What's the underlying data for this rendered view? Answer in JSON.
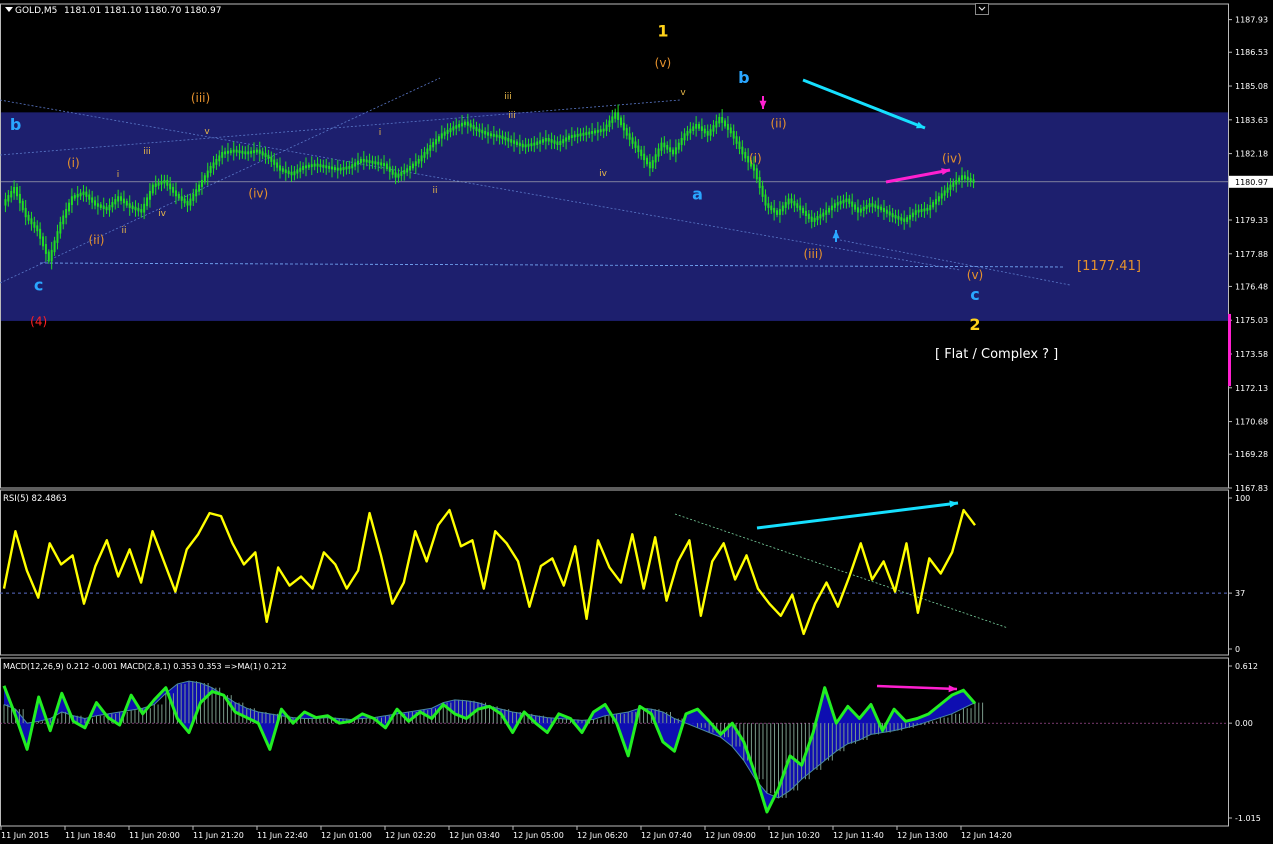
{
  "window": {
    "symbol": "GOLD,M5",
    "ohlc": "1181.01 1181.10 1180.70 1180.97"
  },
  "colors": {
    "background": "#000000",
    "zone": "#1d1f6e",
    "candles": "#22dd22",
    "rsi": "#ffff00",
    "macd_line": "#22ee22",
    "macd_hist": "#1010d0",
    "wave_orange": "#e6922d",
    "wave_yellow": "#ffd21a",
    "wave_blue": "#2aa6ff",
    "wave_red": "#ff2020",
    "arrow_cyan": "#16e0ff",
    "arrow_magenta": "#ff20d0"
  },
  "chart_data": [
    {
      "type": "line",
      "panel": "price",
      "ylim": [
        1167.83,
        1188.6
      ],
      "yticks": [
        "1187.93",
        "1186.53",
        "1185.08",
        "1183.63",
        "1182.18",
        "1180.97",
        "1179.33",
        "1177.88",
        "1176.48",
        "1175.03",
        "1173.58",
        "1172.13",
        "1170.68",
        "1169.28",
        "1167.83"
      ],
      "current_price": "1180.97",
      "xticks": [
        "11 Jun 2015",
        "11 Jun 18:40",
        "11 Jun 20:00",
        "11 Jun 21:20",
        "11 Jun 22:40",
        "12 Jun 01:00",
        "12 Jun 02:20",
        "12 Jun 03:40",
        "12 Jun 05:00",
        "12 Jun 06:20",
        "12 Jun 07:40",
        "12 Jun 09:00",
        "12 Jun 10:20",
        "12 Jun 11:40",
        "12 Jun 13:00",
        "12 Jun 14:20"
      ],
      "close_path": [
        [
          0,
          1180.0
        ],
        [
          1,
          1180.7
        ],
        [
          2,
          1179.5
        ],
        [
          3,
          1178.9
        ],
        [
          4,
          1177.6
        ],
        [
          5,
          1179.2
        ],
        [
          6,
          1180.3
        ],
        [
          7,
          1180.5
        ],
        [
          8,
          1180.0
        ],
        [
          9,
          1179.8
        ],
        [
          10,
          1180.3
        ],
        [
          11,
          1179.9
        ],
        [
          12,
          1179.7
        ],
        [
          13,
          1180.8
        ],
        [
          14,
          1181.0
        ],
        [
          15,
          1180.4
        ],
        [
          16,
          1180.0
        ],
        [
          17,
          1180.8
        ],
        [
          18,
          1181.6
        ],
        [
          19,
          1182.2
        ],
        [
          20,
          1182.3
        ],
        [
          21,
          1182.2
        ],
        [
          22,
          1182.3
        ],
        [
          23,
          1182.0
        ],
        [
          24,
          1181.5
        ],
        [
          25,
          1181.3
        ],
        [
          26,
          1181.6
        ],
        [
          27,
          1181.7
        ],
        [
          28,
          1181.6
        ],
        [
          29,
          1181.5
        ],
        [
          30,
          1181.6
        ],
        [
          31,
          1181.9
        ],
        [
          32,
          1181.8
        ],
        [
          33,
          1181.7
        ],
        [
          34,
          1181.2
        ],
        [
          35,
          1181.5
        ],
        [
          36,
          1181.9
        ],
        [
          37,
          1182.5
        ],
        [
          38,
          1183.0
        ],
        [
          39,
          1183.3
        ],
        [
          40,
          1183.5
        ],
        [
          41,
          1183.2
        ],
        [
          42,
          1183.0
        ],
        [
          43,
          1182.9
        ],
        [
          44,
          1182.7
        ],
        [
          45,
          1182.5
        ],
        [
          46,
          1182.6
        ],
        [
          47,
          1182.8
        ],
        [
          48,
          1182.6
        ],
        [
          49,
          1182.9
        ],
        [
          50,
          1183.0
        ],
        [
          51,
          1183.1
        ],
        [
          52,
          1183.2
        ],
        [
          53,
          1183.9
        ],
        [
          54,
          1183.0
        ],
        [
          55,
          1182.3
        ],
        [
          56,
          1181.6
        ],
        [
          57,
          1182.6
        ],
        [
          58,
          1182.2
        ],
        [
          59,
          1183.0
        ],
        [
          60,
          1183.4
        ],
        [
          61,
          1183.0
        ],
        [
          62,
          1183.7
        ],
        [
          63,
          1183.1
        ],
        [
          64,
          1182.2
        ],
        [
          65,
          1181.5
        ],
        [
          66,
          1180.0
        ],
        [
          67,
          1179.6
        ],
        [
          68,
          1180.2
        ],
        [
          69,
          1179.8
        ],
        [
          70,
          1179.3
        ],
        [
          71,
          1179.6
        ],
        [
          72,
          1180.0
        ],
        [
          73,
          1180.2
        ],
        [
          74,
          1179.7
        ],
        [
          75,
          1180.0
        ],
        [
          76,
          1179.8
        ],
        [
          77,
          1179.5
        ],
        [
          78,
          1179.3
        ],
        [
          79,
          1179.7
        ],
        [
          80,
          1179.8
        ],
        [
          81,
          1180.3
        ],
        [
          82,
          1180.8
        ],
        [
          83,
          1181.2
        ],
        [
          84,
          1180.97
        ]
      ],
      "wave_labels": [
        {
          "text": "b",
          "color": "blue",
          "x": 1,
          "y": 1183.2
        },
        {
          "text": "c",
          "color": "blue",
          "x": 3,
          "y": 1176.3
        },
        {
          "text": "(4)",
          "color": "red",
          "x": 3,
          "y": 1174.8
        },
        {
          "text": "(i)",
          "color": "orange",
          "x": 6,
          "y": 1181.6
        },
        {
          "text": "(ii)",
          "color": "orange",
          "x": 8,
          "y": 1178.3
        },
        {
          "text": "(iii)",
          "color": "orange",
          "x": 17,
          "y": 1184.4
        },
        {
          "text": "(iv)",
          "color": "orange",
          "x": 22,
          "y": 1180.3
        },
        {
          "text": "1",
          "color": "yellow",
          "x": 57,
          "y": 1187.2
        },
        {
          "text": "(v)",
          "color": "orange",
          "x": 57,
          "y": 1185.9
        },
        {
          "text": "b",
          "color": "blue",
          "x": 64,
          "y": 1185.2
        },
        {
          "text": "(ii)",
          "color": "orange",
          "x": 67,
          "y": 1183.3
        },
        {
          "text": "(i)",
          "color": "orange",
          "x": 65,
          "y": 1181.8
        },
        {
          "text": "a",
          "color": "blue",
          "x": 60,
          "y": 1180.2
        },
        {
          "text": "(iii)",
          "color": "orange",
          "x": 70,
          "y": 1177.7
        },
        {
          "text": "(iv)",
          "color": "orange",
          "x": 82,
          "y": 1181.8
        },
        {
          "text": "(v)",
          "color": "orange",
          "x": 84,
          "y": 1176.8
        },
        {
          "text": "c",
          "color": "blue",
          "x": 84,
          "y": 1175.9
        },
        {
          "text": "2",
          "color": "yellow",
          "x": 84,
          "y": 1174.6
        }
      ],
      "minor_labels": [
        "i",
        "ii",
        "iii",
        "iv",
        "v",
        "i",
        "ii",
        "iii",
        "iv",
        "v",
        "iii"
      ],
      "price_tag": "[1177.41]",
      "note": "[ Flat / Complex ? ]"
    },
    {
      "type": "line",
      "panel": "rsi",
      "title": "RSI(5) 82.4863",
      "ylim": [
        0,
        100
      ],
      "yticks": [
        "100",
        "37",
        "0"
      ],
      "level": 37,
      "values": [
        40,
        78,
        52,
        34,
        70,
        56,
        62,
        30,
        55,
        72,
        48,
        66,
        44,
        78,
        58,
        38,
        66,
        76,
        90,
        88,
        70,
        56,
        64,
        18,
        54,
        42,
        48,
        40,
        64,
        56,
        40,
        52,
        90,
        62,
        30,
        44,
        78,
        58,
        82,
        92,
        68,
        72,
        40,
        78,
        70,
        58,
        28,
        55,
        60,
        42,
        68,
        20,
        72,
        54,
        44,
        76,
        40,
        74,
        32,
        58,
        72,
        22,
        58,
        70,
        46,
        62,
        40,
        30,
        22,
        36,
        10,
        30,
        44,
        28,
        48,
        70,
        46,
        58,
        38,
        70,
        24,
        60,
        50,
        64,
        92,
        82
      ]
    },
    {
      "type": "area",
      "panel": "macd",
      "title": "MACD(12,26,9) 0.212 -0.001  MACD(2,8,1) 0.353 0.353  =>MA(1) 0.212",
      "ylim": [
        -1.015,
        0.612
      ],
      "yticks": [
        "0.612",
        "0.00",
        "-1.015"
      ],
      "values": [
        0.4,
        0.08,
        -0.28,
        0.28,
        -0.08,
        0.32,
        0.02,
        -0.05,
        0.22,
        0.06,
        -0.02,
        0.3,
        0.1,
        0.25,
        0.38,
        0.05,
        -0.1,
        0.22,
        0.34,
        0.3,
        0.12,
        0.06,
        0.0,
        -0.28,
        0.15,
        0.0,
        0.12,
        0.06,
        0.08,
        0.0,
        0.02,
        0.1,
        0.05,
        -0.05,
        0.15,
        0.02,
        0.12,
        0.05,
        0.2,
        0.1,
        0.05,
        0.15,
        0.18,
        0.1,
        -0.1,
        0.12,
        0.0,
        -0.1,
        0.1,
        0.05,
        -0.1,
        0.12,
        0.2,
        0.0,
        -0.35,
        0.18,
        0.1,
        -0.2,
        -0.3,
        0.1,
        0.15,
        0.02,
        -0.12,
        0.0,
        -0.2,
        -0.55,
        -0.95,
        -0.7,
        -0.35,
        -0.45,
        -0.1,
        0.38,
        0.0,
        0.18,
        0.05,
        0.2,
        -0.08,
        0.15,
        0.02,
        0.05,
        0.1,
        0.2,
        0.3,
        0.353,
        0.212
      ],
      "signal": [
        0.2,
        0.15,
        0.0,
        0.02,
        0.05,
        0.12,
        0.08,
        0.05,
        0.08,
        0.1,
        0.12,
        0.14,
        0.16,
        0.2,
        0.32,
        0.42,
        0.45,
        0.43,
        0.38,
        0.3,
        0.22,
        0.16,
        0.12,
        0.1,
        0.08,
        0.06,
        0.05,
        0.05,
        0.06,
        0.05,
        0.04,
        0.05,
        0.06,
        0.08,
        0.1,
        0.12,
        0.14,
        0.16,
        0.22,
        0.25,
        0.24,
        0.22,
        0.18,
        0.15,
        0.12,
        0.1,
        0.08,
        0.06,
        0.05,
        0.04,
        0.03,
        0.04,
        0.08,
        0.1,
        0.12,
        0.16,
        0.15,
        0.12,
        0.05,
        0.0,
        -0.05,
        -0.1,
        -0.15,
        -0.25,
        -0.4,
        -0.6,
        -0.75,
        -0.8,
        -0.72,
        -0.6,
        -0.5,
        -0.4,
        -0.3,
        -0.22,
        -0.18,
        -0.12,
        -0.1,
        -0.08,
        -0.05,
        -0.02,
        0.02,
        0.06,
        0.1,
        0.16,
        0.22
      ],
      "xticks": [
        "11 Jun 2015",
        "11 Jun 18:40",
        "11 Jun 20:00",
        "11 Jun 21:20",
        "11 Jun 22:40",
        "12 Jun 01:00",
        "12 Jun 02:20",
        "12 Jun 03:40",
        "12 Jun 05:00",
        "12 Jun 06:20",
        "12 Jun 07:40",
        "12 Jun 09:00",
        "12 Jun 10:20",
        "12 Jun 11:40",
        "12 Jun 13:00",
        "12 Jun 14:20"
      ]
    }
  ]
}
